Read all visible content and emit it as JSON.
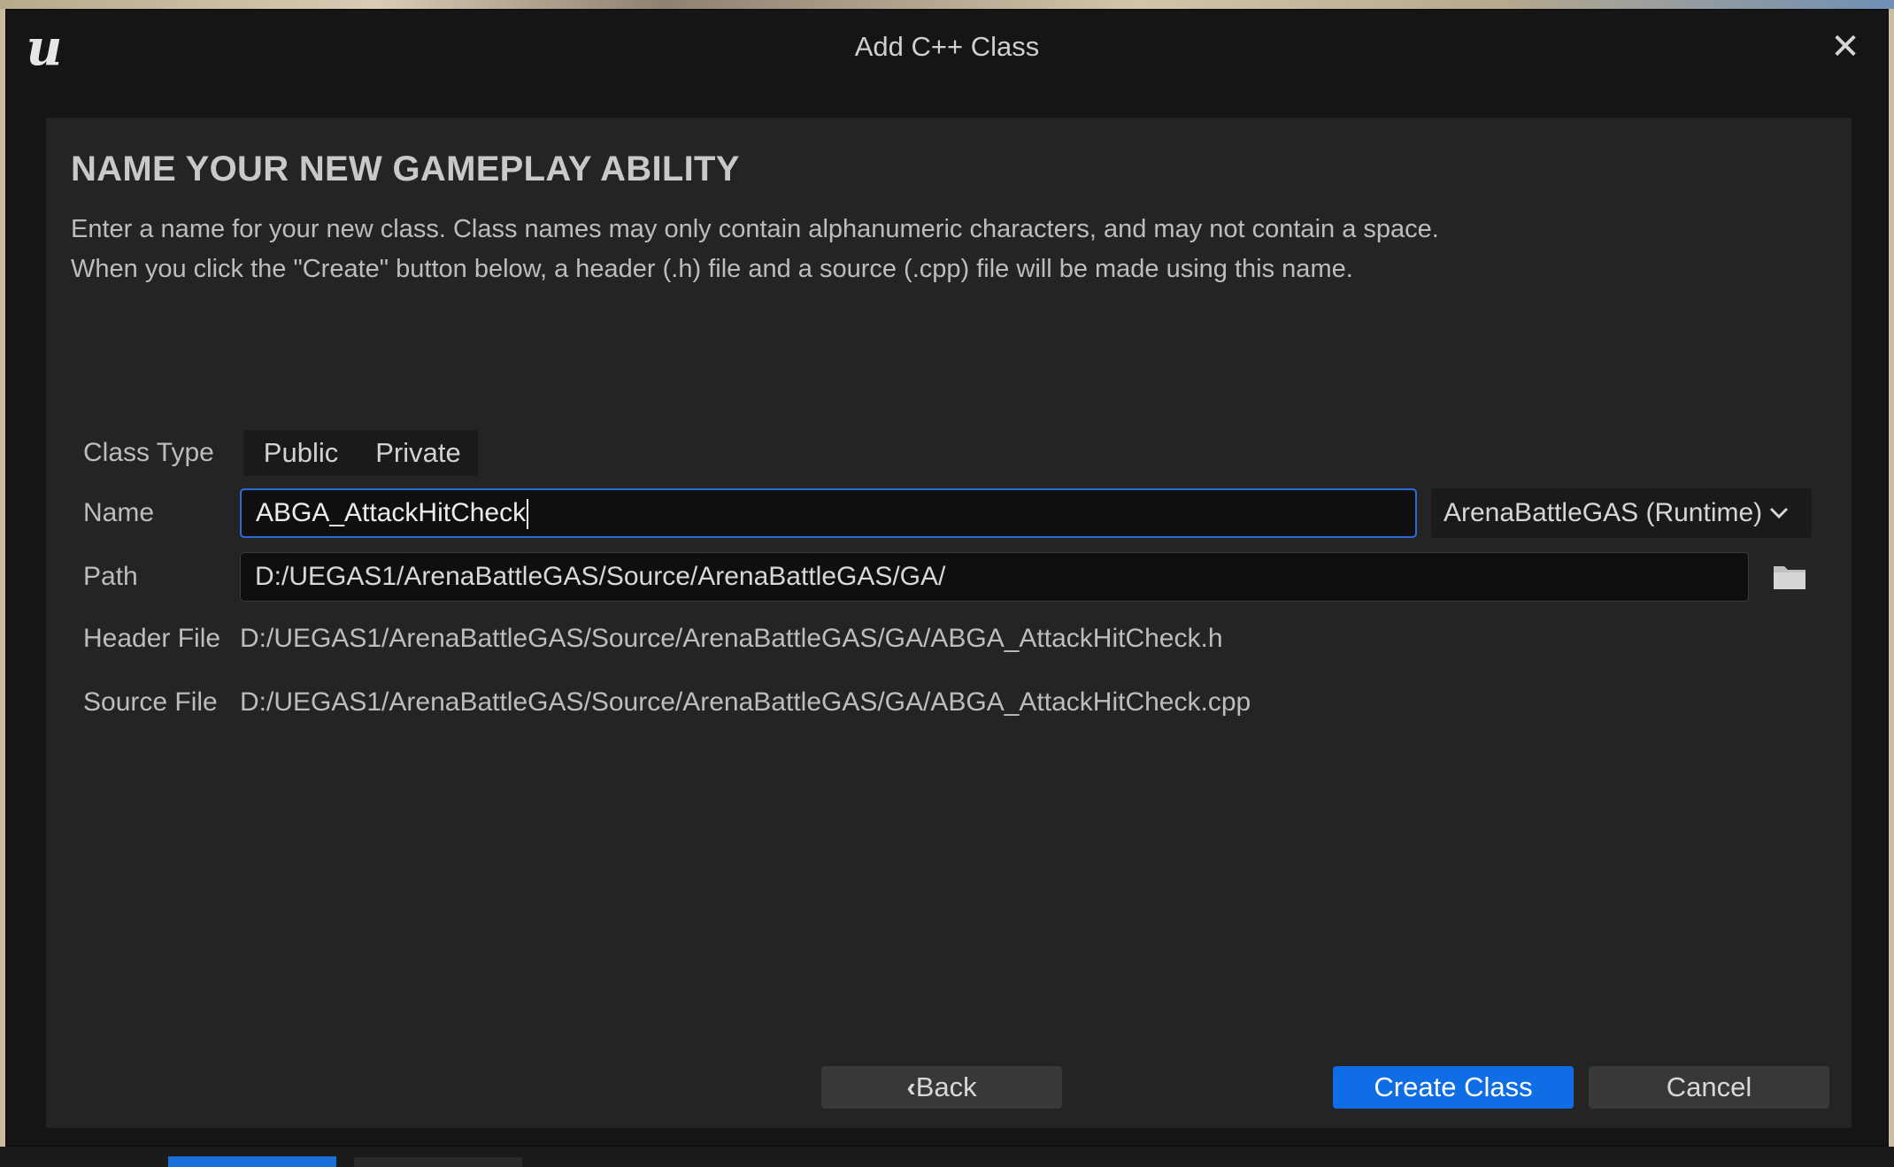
{
  "window": {
    "title": "Add C++ Class",
    "close_label": "✕"
  },
  "header": {
    "heading": "NAME YOUR NEW GAMEPLAY ABILITY",
    "description_line1": "Enter a name for your new class. Class names may only contain alphanumeric characters, and may not contain a space.",
    "description_line2": "When you click the \"Create\" button below, a header (.h) file and a source (.cpp) file will be made using this name."
  },
  "form": {
    "class_type_label": "Class Type",
    "class_type_options": [
      "Public",
      "Private"
    ],
    "name_label": "Name",
    "name_value": "ABGA_AttackHitCheck",
    "module_selected": "ArenaBattleGAS (Runtime)",
    "path_label": "Path",
    "path_value": "D:/UEGAS1/ArenaBattleGAS/Source/ArenaBattleGAS/GA/",
    "header_file_label": "Header File",
    "header_file_value": "D:/UEGAS1/ArenaBattleGAS/Source/ArenaBattleGAS/GA/ABGA_AttackHitCheck.h",
    "source_file_label": "Source File",
    "source_file_value": "D:/UEGAS1/ArenaBattleGAS/Source/ArenaBattleGAS/GA/ABGA_AttackHitCheck.cpp"
  },
  "buttons": {
    "back": "Back",
    "create": "Create Class",
    "cancel": "Cancel"
  },
  "colors": {
    "accent": "#0f6ee6",
    "focus_border": "#2a6ad9",
    "panel_bg": "#242424",
    "window_bg": "#151515"
  },
  "icons": [
    "unreal-logo-icon",
    "close-icon",
    "chevron-down-icon",
    "folder-icon",
    "chevron-left-icon"
  ]
}
